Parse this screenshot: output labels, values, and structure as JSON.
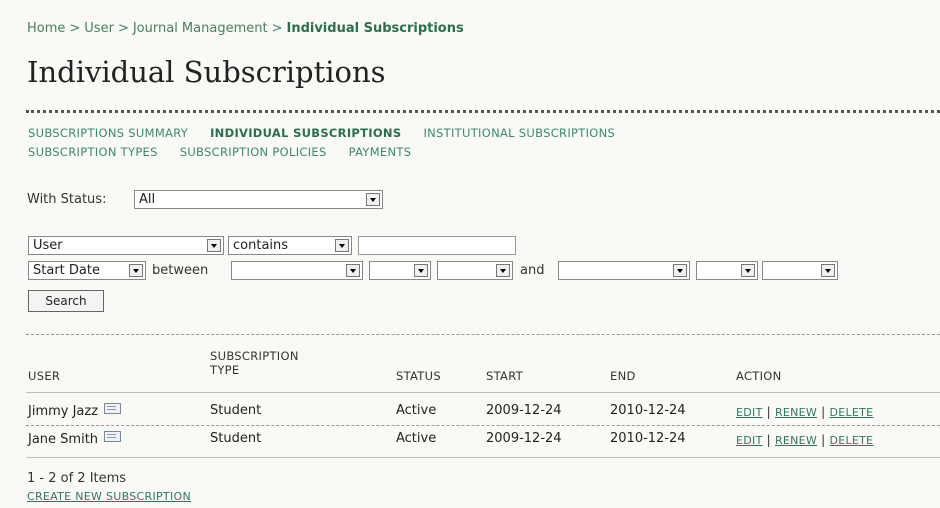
{
  "breadcrumb": {
    "home": "Home",
    "user": "User",
    "journal": "Journal Management",
    "current": "Individual Subscriptions",
    "sep": ">"
  },
  "page_title": "Individual Subscriptions",
  "nav": {
    "row1": [
      "SUBSCRIPTIONS SUMMARY",
      "INDIVIDUAL SUBSCRIPTIONS",
      "INSTITUTIONAL SUBSCRIPTIONS"
    ],
    "row2": [
      "SUBSCRIPTION TYPES",
      "SUBSCRIPTION POLICIES",
      "PAYMENTS"
    ],
    "current": "INDIVIDUAL SUBSCRIPTIONS"
  },
  "filter": {
    "status_label": "With Status:",
    "status_value": "All",
    "search_field": "User",
    "match": "contains",
    "search_value": "",
    "date_field": "Start Date",
    "between_label": "between",
    "and_label": "and",
    "search_button": "Search"
  },
  "table": {
    "headers": {
      "user": "USER",
      "type": "SUBSCRIPTION TYPE",
      "status": "STATUS",
      "start": "START",
      "end": "END",
      "action": "ACTION"
    },
    "rows": [
      {
        "user": "Jimmy Jazz",
        "type": "Student",
        "status": "Active",
        "start": "2009-12-24",
        "end": "2010-12-24"
      },
      {
        "user": "Jane Smith",
        "type": "Student",
        "status": "Active",
        "start": "2009-12-24",
        "end": "2010-12-24"
      }
    ],
    "actions": {
      "edit": "EDIT",
      "renew": "RENEW",
      "delete": "DELETE",
      "sep": "|"
    }
  },
  "footer": {
    "count": "1 - 2 of 2 Items",
    "create_link": "CREATE NEW SUBSCRIPTION"
  },
  "colors": {
    "link": "#2f7a56",
    "background": "#f9f9f6",
    "heading": "#222222"
  }
}
